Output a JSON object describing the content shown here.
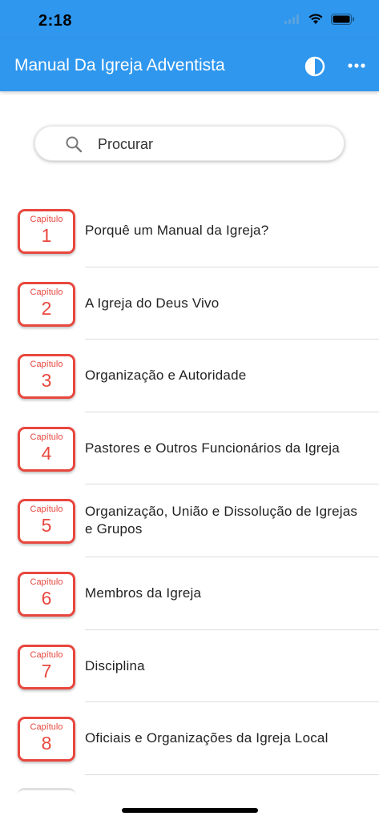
{
  "status": {
    "time": "2:18"
  },
  "app_bar": {
    "title": "Manual Da Igreja Adventista"
  },
  "search": {
    "placeholder": "Procurar"
  },
  "chapter_label": "Capítulo",
  "chapters": [
    {
      "num": "1",
      "title": "Porquê um Manual da Igreja?"
    },
    {
      "num": "2",
      "title": "A Igreja do Deus Vivo"
    },
    {
      "num": "3",
      "title": "Organização e Autoridade"
    },
    {
      "num": "4",
      "title": "Pastores e Outros Funcionários da Igreja"
    },
    {
      "num": "5",
      "title": "Organização, União e Dissolução de Igrejas e Grupos"
    },
    {
      "num": "6",
      "title": "Membros da Igreja"
    },
    {
      "num": "7",
      "title": "Disciplina"
    },
    {
      "num": "8",
      "title": "Oficiais e Organizações da Igreja Local"
    }
  ],
  "colors": {
    "primary": "#2f97ee",
    "accent": "#e8473e"
  },
  "icons": {
    "contrast": "contrast-icon",
    "more": "more-horizontal-icon",
    "search": "search-icon"
  }
}
